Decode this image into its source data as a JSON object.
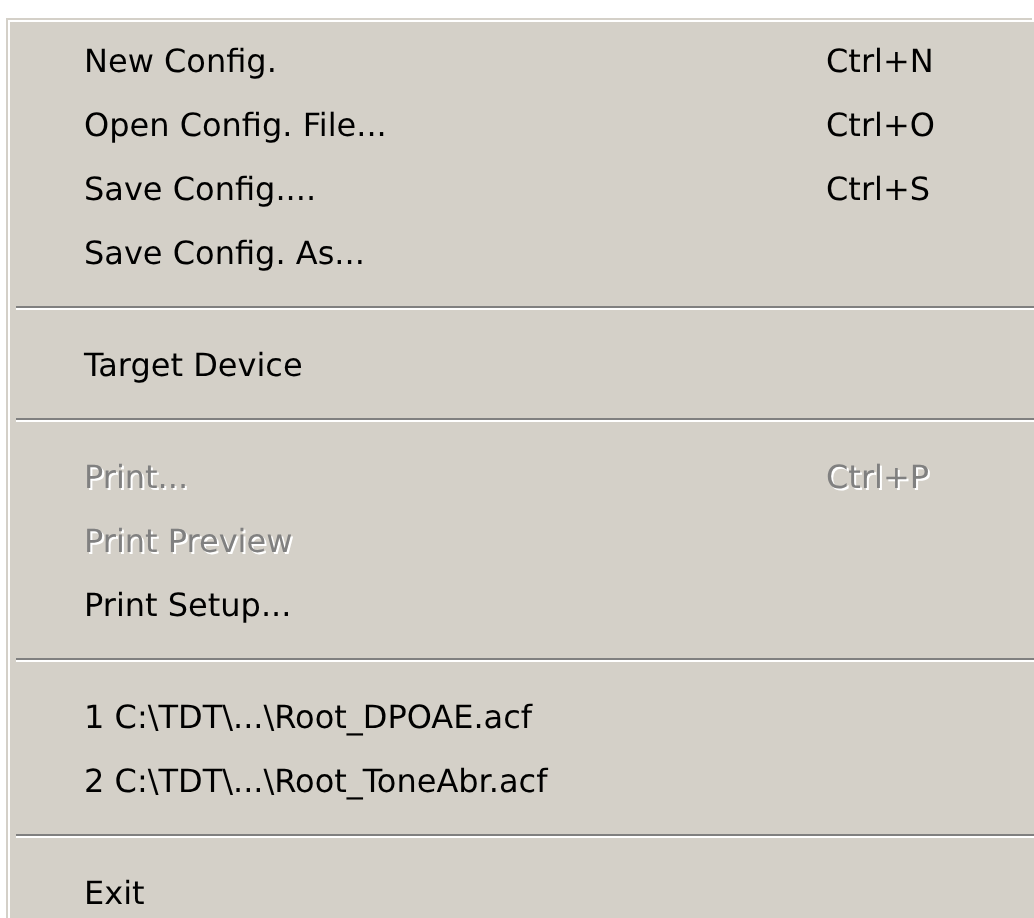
{
  "menu": {
    "groups": [
      {
        "items": [
          {
            "label": "New Config.",
            "shortcut": "Ctrl+N",
            "disabled": false
          },
          {
            "label": "Open Config. File...",
            "shortcut": "Ctrl+O",
            "disabled": false
          },
          {
            "label": "Save Config....",
            "shortcut": "Ctrl+S",
            "disabled": false
          },
          {
            "label": "Save Config. As...",
            "disabled": false
          }
        ]
      },
      {
        "items": [
          {
            "label": "Target Device",
            "disabled": false
          }
        ]
      },
      {
        "items": [
          {
            "label": "Print...",
            "shortcut": "Ctrl+P",
            "disabled": true
          },
          {
            "label": "Print Preview",
            "disabled": true
          },
          {
            "label": "Print Setup...",
            "disabled": false
          }
        ]
      },
      {
        "items": [
          {
            "label": "1 C:\\TDT\\...\\Root_DPOAE.acf",
            "disabled": false
          },
          {
            "label": "2 C:\\TDT\\...\\Root_ToneAbr.acf",
            "disabled": false
          }
        ]
      },
      {
        "items": [
          {
            "label": "Exit",
            "disabled": false
          }
        ]
      }
    ]
  }
}
